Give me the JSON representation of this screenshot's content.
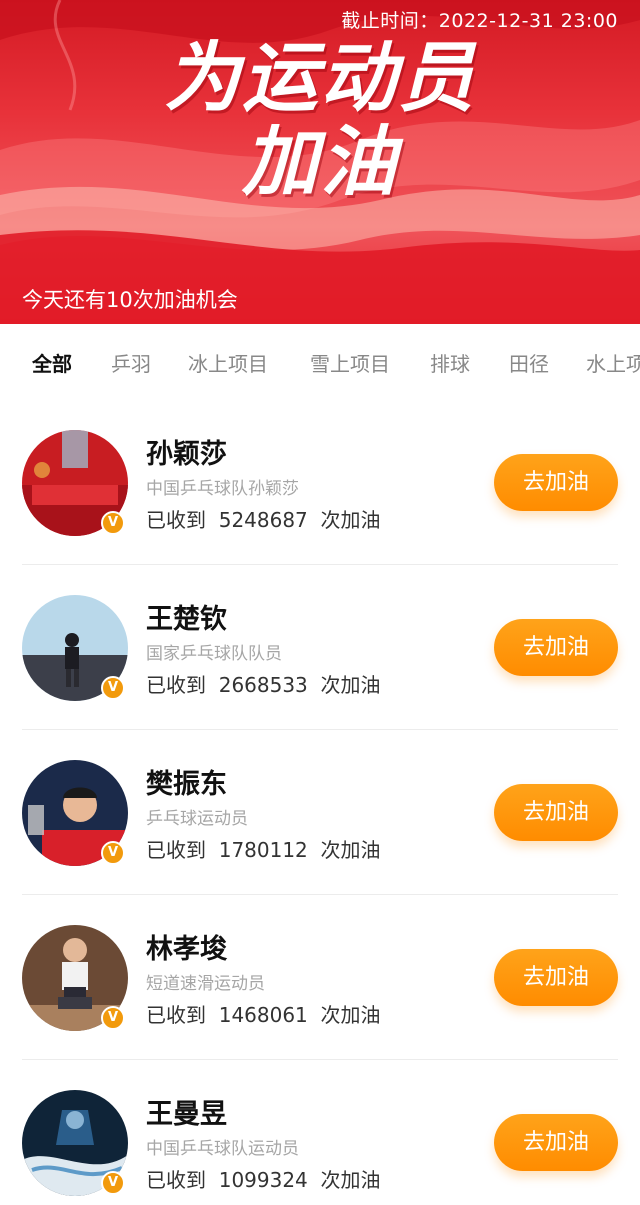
{
  "banner": {
    "deadline": "截止时间：2022-12-31 23:00",
    "headline_line1": "为运动员",
    "headline_line2": "加油",
    "chances": "今天还有10次加油机会"
  },
  "tabs": [
    {
      "label": "全部",
      "active": true
    },
    {
      "label": "乒羽",
      "active": false
    },
    {
      "label": "冰上项目",
      "active": false
    },
    {
      "label": "雪上项目",
      "active": false
    },
    {
      "label": "排球",
      "active": false
    },
    {
      "label": "田径",
      "active": false
    },
    {
      "label": "水上项",
      "active": false
    }
  ],
  "athletes": [
    {
      "name": "孙颖莎",
      "desc": "中国乒乓球队孙颖莎",
      "received": "已收到  5248687  次加油",
      "button": "去加油",
      "badge": "V"
    },
    {
      "name": "王楚钦",
      "desc": "国家乒乓球队队员",
      "received": "已收到  2668533  次加油",
      "button": "去加油",
      "badge": "V"
    },
    {
      "name": "樊振东",
      "desc": "乒乓球运动员",
      "received": "已收到  1780112  次加油",
      "button": "去加油",
      "badge": "V"
    },
    {
      "name": "林孝埈",
      "desc": "短道速滑运动员",
      "received": "已收到  1468061  次加油",
      "button": "去加油",
      "badge": "V"
    },
    {
      "name": "王曼昱",
      "desc": "中国乒乓球队运动员",
      "received": "已收到  1099324  次加油",
      "button": "去加油",
      "badge": "V"
    }
  ],
  "colors": {
    "accent": "#ff9410",
    "banner_red": "#e4252f",
    "badge": "#f29a0c"
  }
}
